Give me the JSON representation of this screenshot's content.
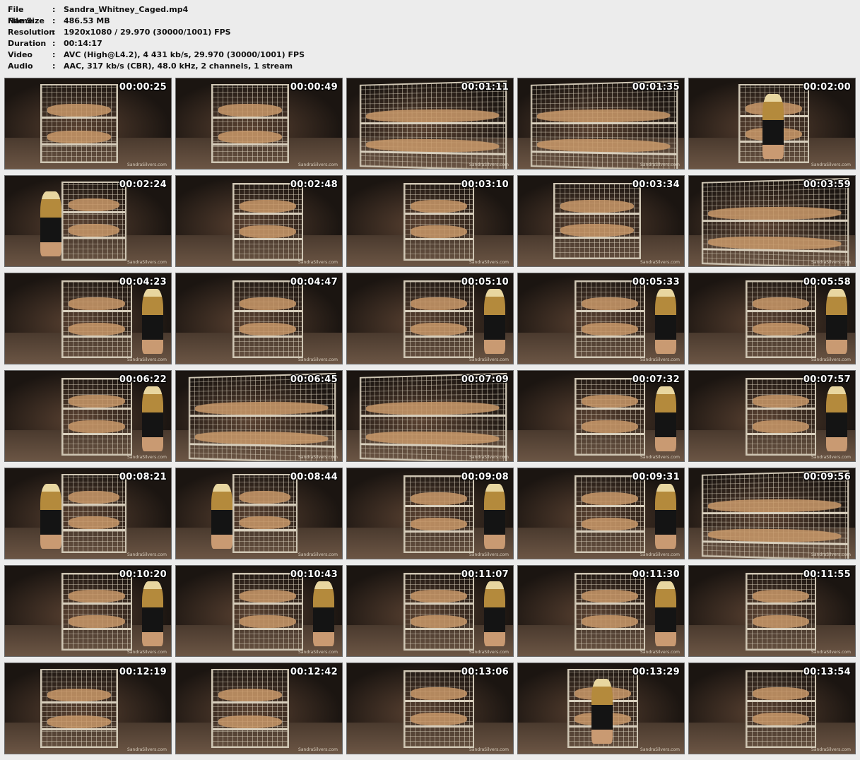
{
  "info": [
    {
      "key": "File Name",
      "value": "Sandra_Whitney_Caged.mp4"
    },
    {
      "key": "File Size",
      "value": "486.53 MB"
    },
    {
      "key": "Resolution",
      "value": "1920x1080 / 29.970 (30000/1001) FPS"
    },
    {
      "key": "Duration",
      "value": "00:14:17"
    },
    {
      "key": "Video",
      "value": "AVC (High@L4.2), 4 431 kb/s, 29.970 (30000/1001) FPS"
    },
    {
      "key": "Audio",
      "value": "AAC, 317 kb/s (CBR), 48.0 kHz, 2 channels, 1 stream"
    }
  ],
  "separator": ":",
  "watermark": "SandraSilvers.com",
  "thumbnails": [
    {
      "time": "00:00:25",
      "variant": "close",
      "figure": false
    },
    {
      "time": "00:00:49",
      "variant": "close",
      "figure": false
    },
    {
      "time": "00:01:11",
      "variant": "wide-close",
      "figure": false
    },
    {
      "time": "00:01:35",
      "variant": "wide-close",
      "figure": false
    },
    {
      "time": "00:02:00",
      "variant": "cage-person-front",
      "figure": true
    },
    {
      "time": "00:02:24",
      "variant": "cage-person-left",
      "figure": true
    },
    {
      "time": "00:02:48",
      "variant": "cage",
      "figure": false
    },
    {
      "time": "00:03:10",
      "variant": "cage",
      "figure": false
    },
    {
      "time": "00:03:34",
      "variant": "cage-lit",
      "figure": false
    },
    {
      "time": "00:03:59",
      "variant": "wide-close",
      "figure": false
    },
    {
      "time": "00:04:23",
      "variant": "cage-person-right",
      "figure": true
    },
    {
      "time": "00:04:47",
      "variant": "cage",
      "figure": false
    },
    {
      "time": "00:05:10",
      "variant": "cage-person-right",
      "figure": true
    },
    {
      "time": "00:05:33",
      "variant": "cage-person-right",
      "figure": true
    },
    {
      "time": "00:05:58",
      "variant": "cage-person-right",
      "figure": true
    },
    {
      "time": "00:06:22",
      "variant": "cage-person-right",
      "figure": true
    },
    {
      "time": "00:06:45",
      "variant": "wide-close",
      "figure": false
    },
    {
      "time": "00:07:09",
      "variant": "wide-close",
      "figure": false
    },
    {
      "time": "00:07:32",
      "variant": "cage-person-right",
      "figure": true
    },
    {
      "time": "00:07:57",
      "variant": "cage-person-right",
      "figure": true
    },
    {
      "time": "00:08:21",
      "variant": "cage-person-left",
      "figure": true
    },
    {
      "time": "00:08:44",
      "variant": "cage-person-left",
      "figure": true
    },
    {
      "time": "00:09:08",
      "variant": "cage-person-right",
      "figure": true
    },
    {
      "time": "00:09:31",
      "variant": "cage-person-right",
      "figure": true
    },
    {
      "time": "00:09:56",
      "variant": "wide-close",
      "figure": false
    },
    {
      "time": "00:10:20",
      "variant": "cage-person-right",
      "figure": true
    },
    {
      "time": "00:10:43",
      "variant": "cage-person-right",
      "figure": true
    },
    {
      "time": "00:11:07",
      "variant": "cage-person-right",
      "figure": true
    },
    {
      "time": "00:11:30",
      "variant": "cage-person-right",
      "figure": true
    },
    {
      "time": "00:11:55",
      "variant": "cage",
      "figure": false
    },
    {
      "time": "00:12:19",
      "variant": "close",
      "figure": false
    },
    {
      "time": "00:12:42",
      "variant": "close",
      "figure": false
    },
    {
      "time": "00:13:06",
      "variant": "cage",
      "figure": false
    },
    {
      "time": "00:13:29",
      "variant": "cage-person-front",
      "figure": true
    },
    {
      "time": "00:13:54",
      "variant": "cage",
      "figure": false
    }
  ],
  "colors": {
    "background": "#ececec",
    "frame_dark": "#1b1511",
    "floor": "#4a3a2e",
    "cage_wire": "#cfc6b4",
    "skin": "#c89868",
    "outfit_gold": "#b48a3c",
    "outfit_black": "#141414",
    "timecode": "#ffffff"
  }
}
